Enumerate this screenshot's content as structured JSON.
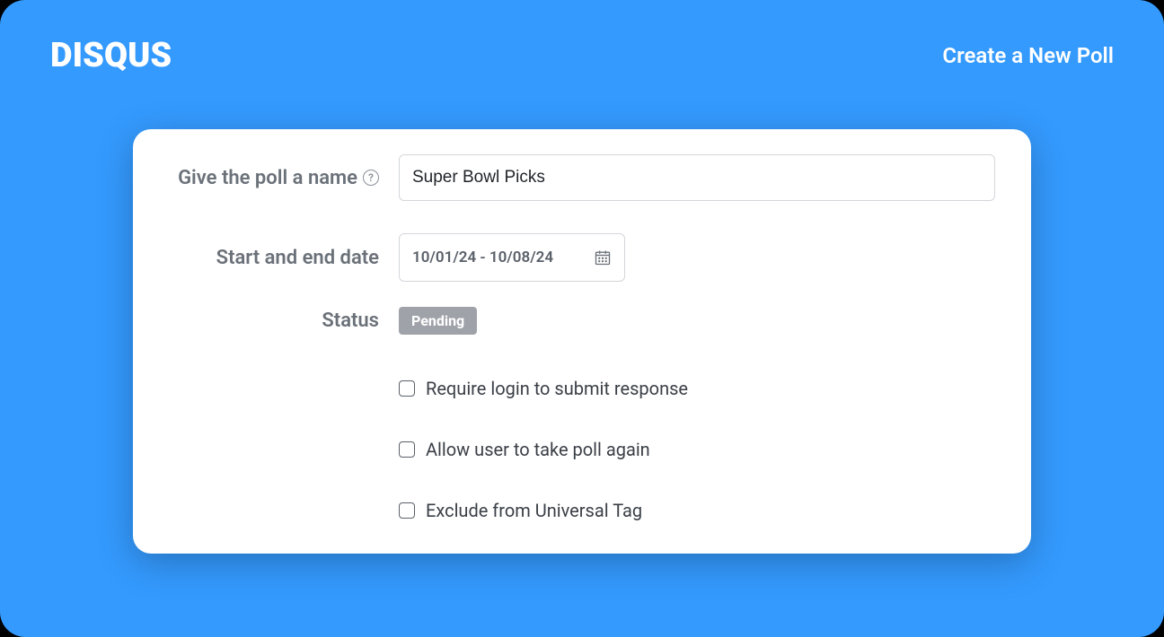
{
  "header": {
    "logo": "DISQUS",
    "action_label": "Create a New Poll"
  },
  "form": {
    "name_label": "Give the poll a name",
    "name_value": "Super Bowl Picks",
    "date_label": "Start and end date",
    "date_value": "10/01/24 - 10/08/24",
    "status_label": "Status",
    "status_value": "Pending",
    "checkboxes": [
      {
        "label": "Require login to submit response",
        "checked": false
      },
      {
        "label": "Allow user to take poll again",
        "checked": false
      },
      {
        "label": "Exclude from Universal Tag",
        "checked": false
      }
    ]
  }
}
